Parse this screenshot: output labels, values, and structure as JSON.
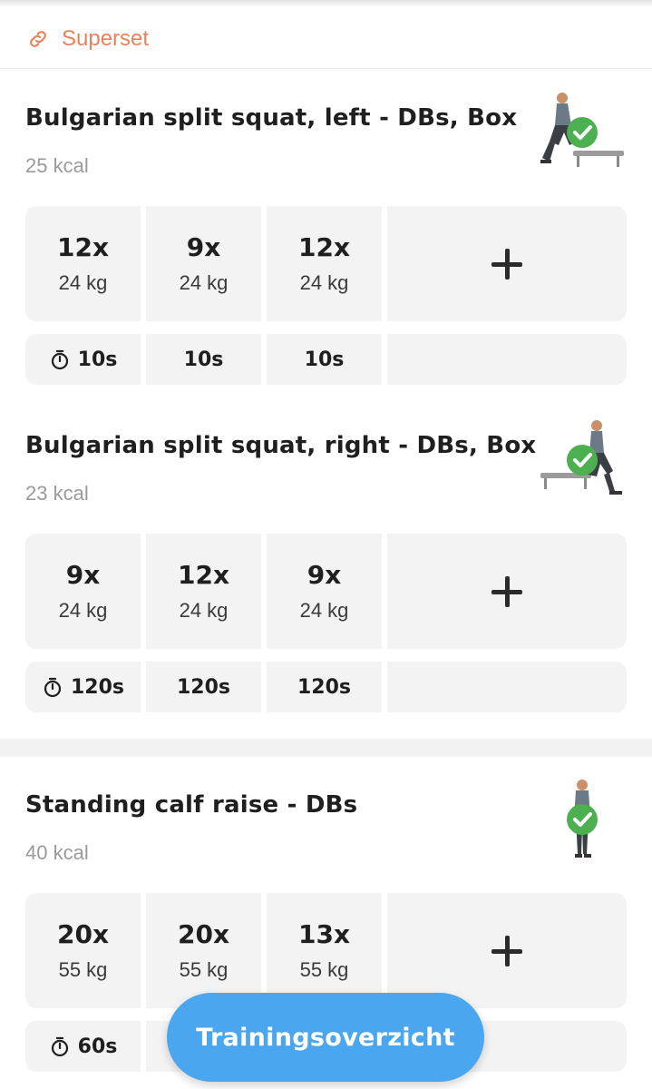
{
  "superset": {
    "label": "Superset",
    "icon": "link-icon",
    "color": "#e8825a"
  },
  "accent_check": "#4cb050",
  "exercises": [
    {
      "title": "Bulgarian split squat, left - DBs, Box",
      "kcal": "25 kcal",
      "completed": true,
      "sets": [
        {
          "reps": "12x",
          "weight": "24 kg"
        },
        {
          "reps": "9x",
          "weight": "24 kg"
        },
        {
          "reps": "12x",
          "weight": "24 kg"
        }
      ],
      "rests": [
        "10s",
        "10s",
        "10s"
      ]
    },
    {
      "title": "Bulgarian split squat, right - DBs, Box",
      "kcal": "23 kcal",
      "completed": true,
      "sets": [
        {
          "reps": "9x",
          "weight": "24 kg"
        },
        {
          "reps": "12x",
          "weight": "24 kg"
        },
        {
          "reps": "9x",
          "weight": "24 kg"
        }
      ],
      "rests": [
        "120s",
        "120s",
        "120s"
      ]
    },
    {
      "title": "Standing calf raise - DBs",
      "kcal": "40 kcal",
      "completed": true,
      "sets": [
        {
          "reps": "20x",
          "weight": "55 kg"
        },
        {
          "reps": "20x",
          "weight": "55 kg"
        },
        {
          "reps": "13x",
          "weight": "55 kg"
        }
      ],
      "rests": [
        "60s"
      ]
    }
  ],
  "fab": {
    "label": "Trainingsoverzicht",
    "color": "#4aa6ef"
  }
}
